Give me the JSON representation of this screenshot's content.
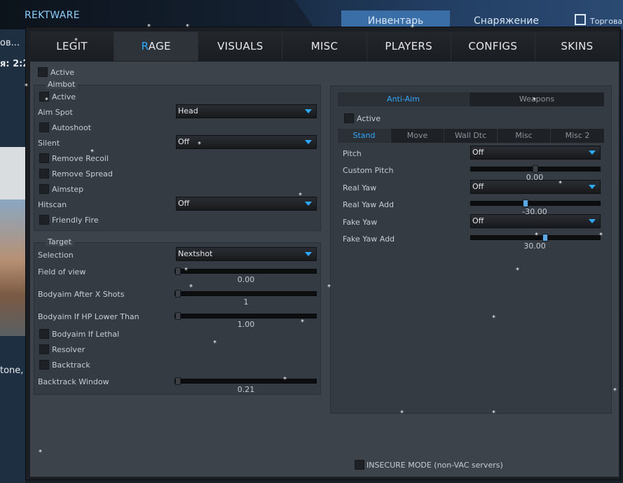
{
  "background": {
    "brand": "REKTWARE",
    "tabs": [
      "Инвентарь",
      "Снаряжение"
    ],
    "trade_label": "Торговая",
    "side_texts": [
      "ов...",
      "я: 2:2",
      "tone,"
    ]
  },
  "main_tabs": [
    {
      "pre": "LEGIT",
      "hl": "",
      "post": ""
    },
    {
      "pre": "",
      "hl": "R",
      "post": "AGE"
    },
    {
      "pre": "VISUALS",
      "hl": "",
      "post": ""
    },
    {
      "pre": "MISC",
      "hl": "",
      "post": ""
    },
    {
      "pre": "PLAYERS",
      "hl": "",
      "post": ""
    },
    {
      "pre": "CONFIGS",
      "hl": "",
      "post": ""
    },
    {
      "pre": "SKINS",
      "hl": "",
      "post": ""
    }
  ],
  "active_tab": "RAGE",
  "rage": {
    "active_label": "Active",
    "aimbot": {
      "title": "Aimbot",
      "active": "Active",
      "aim_spot": {
        "label": "Aim Spot",
        "value": "Head"
      },
      "autoshoot": "Autoshoot",
      "silent": {
        "label": "Silent",
        "value": "Off"
      },
      "remove_recoil": "Remove Recoil",
      "remove_spread": "Remove Spread",
      "aimstep": "Aimstep",
      "hitscan": {
        "label": "Hitscan",
        "value": "Off"
      },
      "friendly_fire": "Friendly Fire"
    },
    "target": {
      "title": "Target",
      "selection": {
        "label": "Selection",
        "value": "Nextshot"
      },
      "fov": {
        "label": "Field of view",
        "value": "0.00",
        "fraction": 0.0
      },
      "bodyaim_shots": {
        "label": "Bodyaim After X Shots",
        "value": "1",
        "fraction": 0.0
      },
      "bodyaim_hp": {
        "label": "Bodyaim If HP Lower Than",
        "value": "1.00",
        "fraction": 0.0
      },
      "bodyaim_lethal": "Bodyaim If Lethal",
      "resolver": "Resolver",
      "backtrack": "Backtrack",
      "backtrack_window": {
        "label": "Backtrack Window",
        "value": "0.21",
        "fraction": 0.0
      }
    },
    "antiaim": {
      "tabs": [
        "Anti-Aim",
        "Weapons"
      ],
      "active": "Active",
      "subtabs": [
        "Stand",
        "Move",
        "Wall Dtc",
        "Misc",
        "Misc 2"
      ],
      "pitch": {
        "label": "Pitch",
        "value": "Off"
      },
      "custom_pitch": {
        "label": "Custom Pitch",
        "value": "0.00",
        "fraction": 0.5
      },
      "real_yaw": {
        "label": "Real Yaw",
        "value": "Off"
      },
      "real_yaw_add": {
        "label": "Real Yaw Add",
        "value": "-30.00",
        "fraction": 0.42
      },
      "fake_yaw": {
        "label": "Fake Yaw",
        "value": "Off"
      },
      "fake_yaw_add": {
        "label": "Fake Yaw Add",
        "value": "30.00",
        "fraction": 0.58
      }
    },
    "insecure": "INSECURE MODE (non-VAC servers)"
  },
  "colors": {
    "accent": "#2fa8ff",
    "panel": "#3c434b",
    "group": "#343b43"
  }
}
